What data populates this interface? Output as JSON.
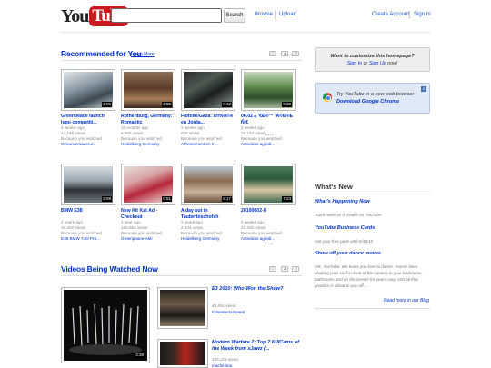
{
  "header": {
    "logo_you": "You",
    "logo_tube": "Tube",
    "search_placeholder": "",
    "search_button": "Search",
    "browse": "Browse",
    "upload": "Upload",
    "create_account": "Create Account",
    "sign_in": "Sign In"
  },
  "recommended": {
    "title": "Recommended for You",
    "learn_more": "Learn More",
    "videos": [
      {
        "title": "Greenpeace launch logo competiti...",
        "age": "4 weeks ago",
        "views": "14,746 views",
        "reason": "Because you watched",
        "source": "Ozeanversauerun",
        "duration": "2:05"
      },
      {
        "title": "Rothenburg, Germany: Romantic",
        "age": "10 months ago",
        "views": "5,666 views",
        "reason": "Because you watched",
        "source": "Heidelberg Germany",
        "duration": "2:02"
      },
      {
        "title": "Flottille/Gaza: arrivÃ©e en Jorda...",
        "age": "2 weeks ago",
        "views": "636 views",
        "reason": "Because you watched",
        "source": "Affrontement en m...",
        "duration": "0:42"
      },
      {
        "title": "06.02 ۞ '€Ð®™ 'Ã©Ð®Ê Ñ‚€",
        "age": "2 weeks ago",
        "views": "28,166 views",
        "reason": "Because you watched",
        "source": "Activistas agredi...",
        "duration": "6:38"
      },
      {
        "title": "BMW E38",
        "age": "2 years ago",
        "views": "19,402 views",
        "reason": "Because you watched",
        "source": "E38 BMW 740i Pro...",
        "duration": "3:09"
      },
      {
        "title": "New Kit Kat Ad - Checkout",
        "age": "1 year ago",
        "views": "165,563 views",
        "reason": "Because you watched",
        "source": "Greenpeace-Akti",
        "duration": "0:51"
      },
      {
        "title": "A day out in Tauberbischofsh",
        "age": "2 years ago",
        "views": "2,544 views",
        "reason": "Because you watched",
        "source": "Heidelberg Germany",
        "duration": "6:17"
      },
      {
        "title": "20100602-6",
        "age": "2 weeks ago",
        "views": "21,326 views",
        "reason": "Because you watched",
        "source": "Activistas agredi...",
        "duration": "7:23"
      }
    ]
  },
  "customize": {
    "line1": "Want to customize this homepage?",
    "sign_in": "Sign In",
    "or": "or",
    "sign_up": "Sign Up",
    "now": "now!"
  },
  "chrome_promo": {
    "line1": "Try YouTube in a new web browser",
    "line2": "Download Google Chrome",
    "close": "x"
  },
  "whats_new": {
    "title": "What's New",
    "items": [
      {
        "heading": "What's Happening Now",
        "text": "Track news as it breaks on YouTube"
      },
      {
        "heading": "YouTube Business Cards",
        "text": "Get your free pack until 6/30/10"
      },
      {
        "heading": "Show off your dance moves",
        "text": "OK, YouTube. We know you love to dance. You've been shaking your stuff in front of the camera in your bedrooms, bathrooms and on the streets for years now. And all that practice is about to pay off...."
      }
    ],
    "read_more": "Read more in our Blog"
  },
  "watched_now": {
    "title": "Videos Being Watched Now",
    "big_duration": "3:39",
    "items": [
      {
        "title": "E3 2010: Who Won the Show?",
        "views": "48,951 views",
        "channel": "IGNentertainment"
      },
      {
        "title": "Modern Warfare 2: Top 7 KillCams of the Week from xJawz (...",
        "views": "135,213 views",
        "channel": "machinima"
      }
    ]
  },
  "colors": {
    "link": "#0033cc",
    "brand_red": "#cc181e",
    "chrome_bg": "#dfe8f5"
  }
}
